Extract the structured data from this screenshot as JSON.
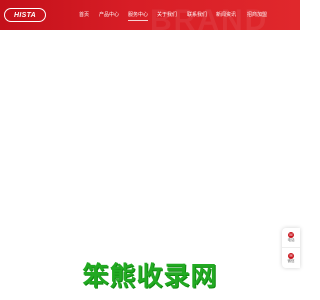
{
  "header": {
    "logo_text": "HISTA",
    "watermark": "BRAND",
    "nav": [
      {
        "label": "首页",
        "active": false
      },
      {
        "label": "产品中心",
        "active": false
      },
      {
        "label": "服务中心",
        "active": true
      },
      {
        "label": "关于我们",
        "active": false
      },
      {
        "label": "联系我们",
        "active": false
      },
      {
        "label": "新闻资讯",
        "active": false
      },
      {
        "label": "招商加盟",
        "active": false
      }
    ]
  },
  "side_tools": {
    "phone": {
      "label": "电话",
      "icon": "phone-icon"
    },
    "wechat": {
      "label": "微信",
      "icon": "wechat-icon"
    }
  },
  "footer_watermark": "笨熊收录网",
  "colors": {
    "brand_red": "#d81e26",
    "watermark_green": "#22aa22"
  }
}
